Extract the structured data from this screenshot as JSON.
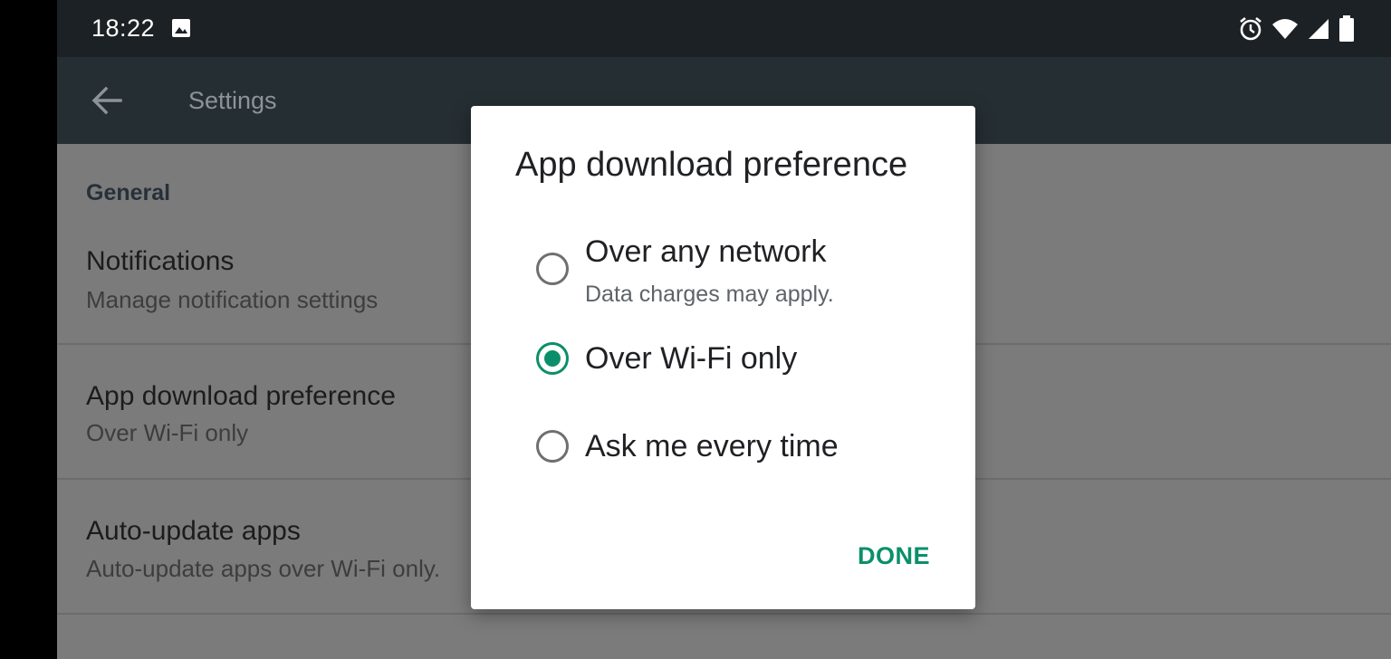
{
  "status_bar": {
    "time": "18:22",
    "icons": [
      "image-icon",
      "alarm-icon",
      "wifi-icon",
      "signal-icon",
      "battery-icon"
    ]
  },
  "app_bar": {
    "back_icon": "arrow-back-icon",
    "title": "Settings"
  },
  "settings": {
    "section_header": "General",
    "items": [
      {
        "title": "Notifications",
        "subtitle": "Manage notification settings"
      },
      {
        "title": "App download preference",
        "subtitle": "Over Wi-Fi only"
      },
      {
        "title": "Auto-update apps",
        "subtitle": "Auto-update apps over Wi-Fi only."
      }
    ]
  },
  "dialog": {
    "title": "App download preference",
    "options": [
      {
        "label": "Over any network",
        "subtitle": "Data charges may apply.",
        "selected": false
      },
      {
        "label": "Over Wi-Fi only",
        "selected": true
      },
      {
        "label": "Ask me every time",
        "selected": false
      }
    ],
    "done_label": "DONE"
  },
  "colors": {
    "accent": "#0b8f6a",
    "status_bar": "#1c2125",
    "app_bar": "#252e33",
    "scrim_content": "#7b7b7b",
    "dialog_bg": "#ffffff"
  }
}
